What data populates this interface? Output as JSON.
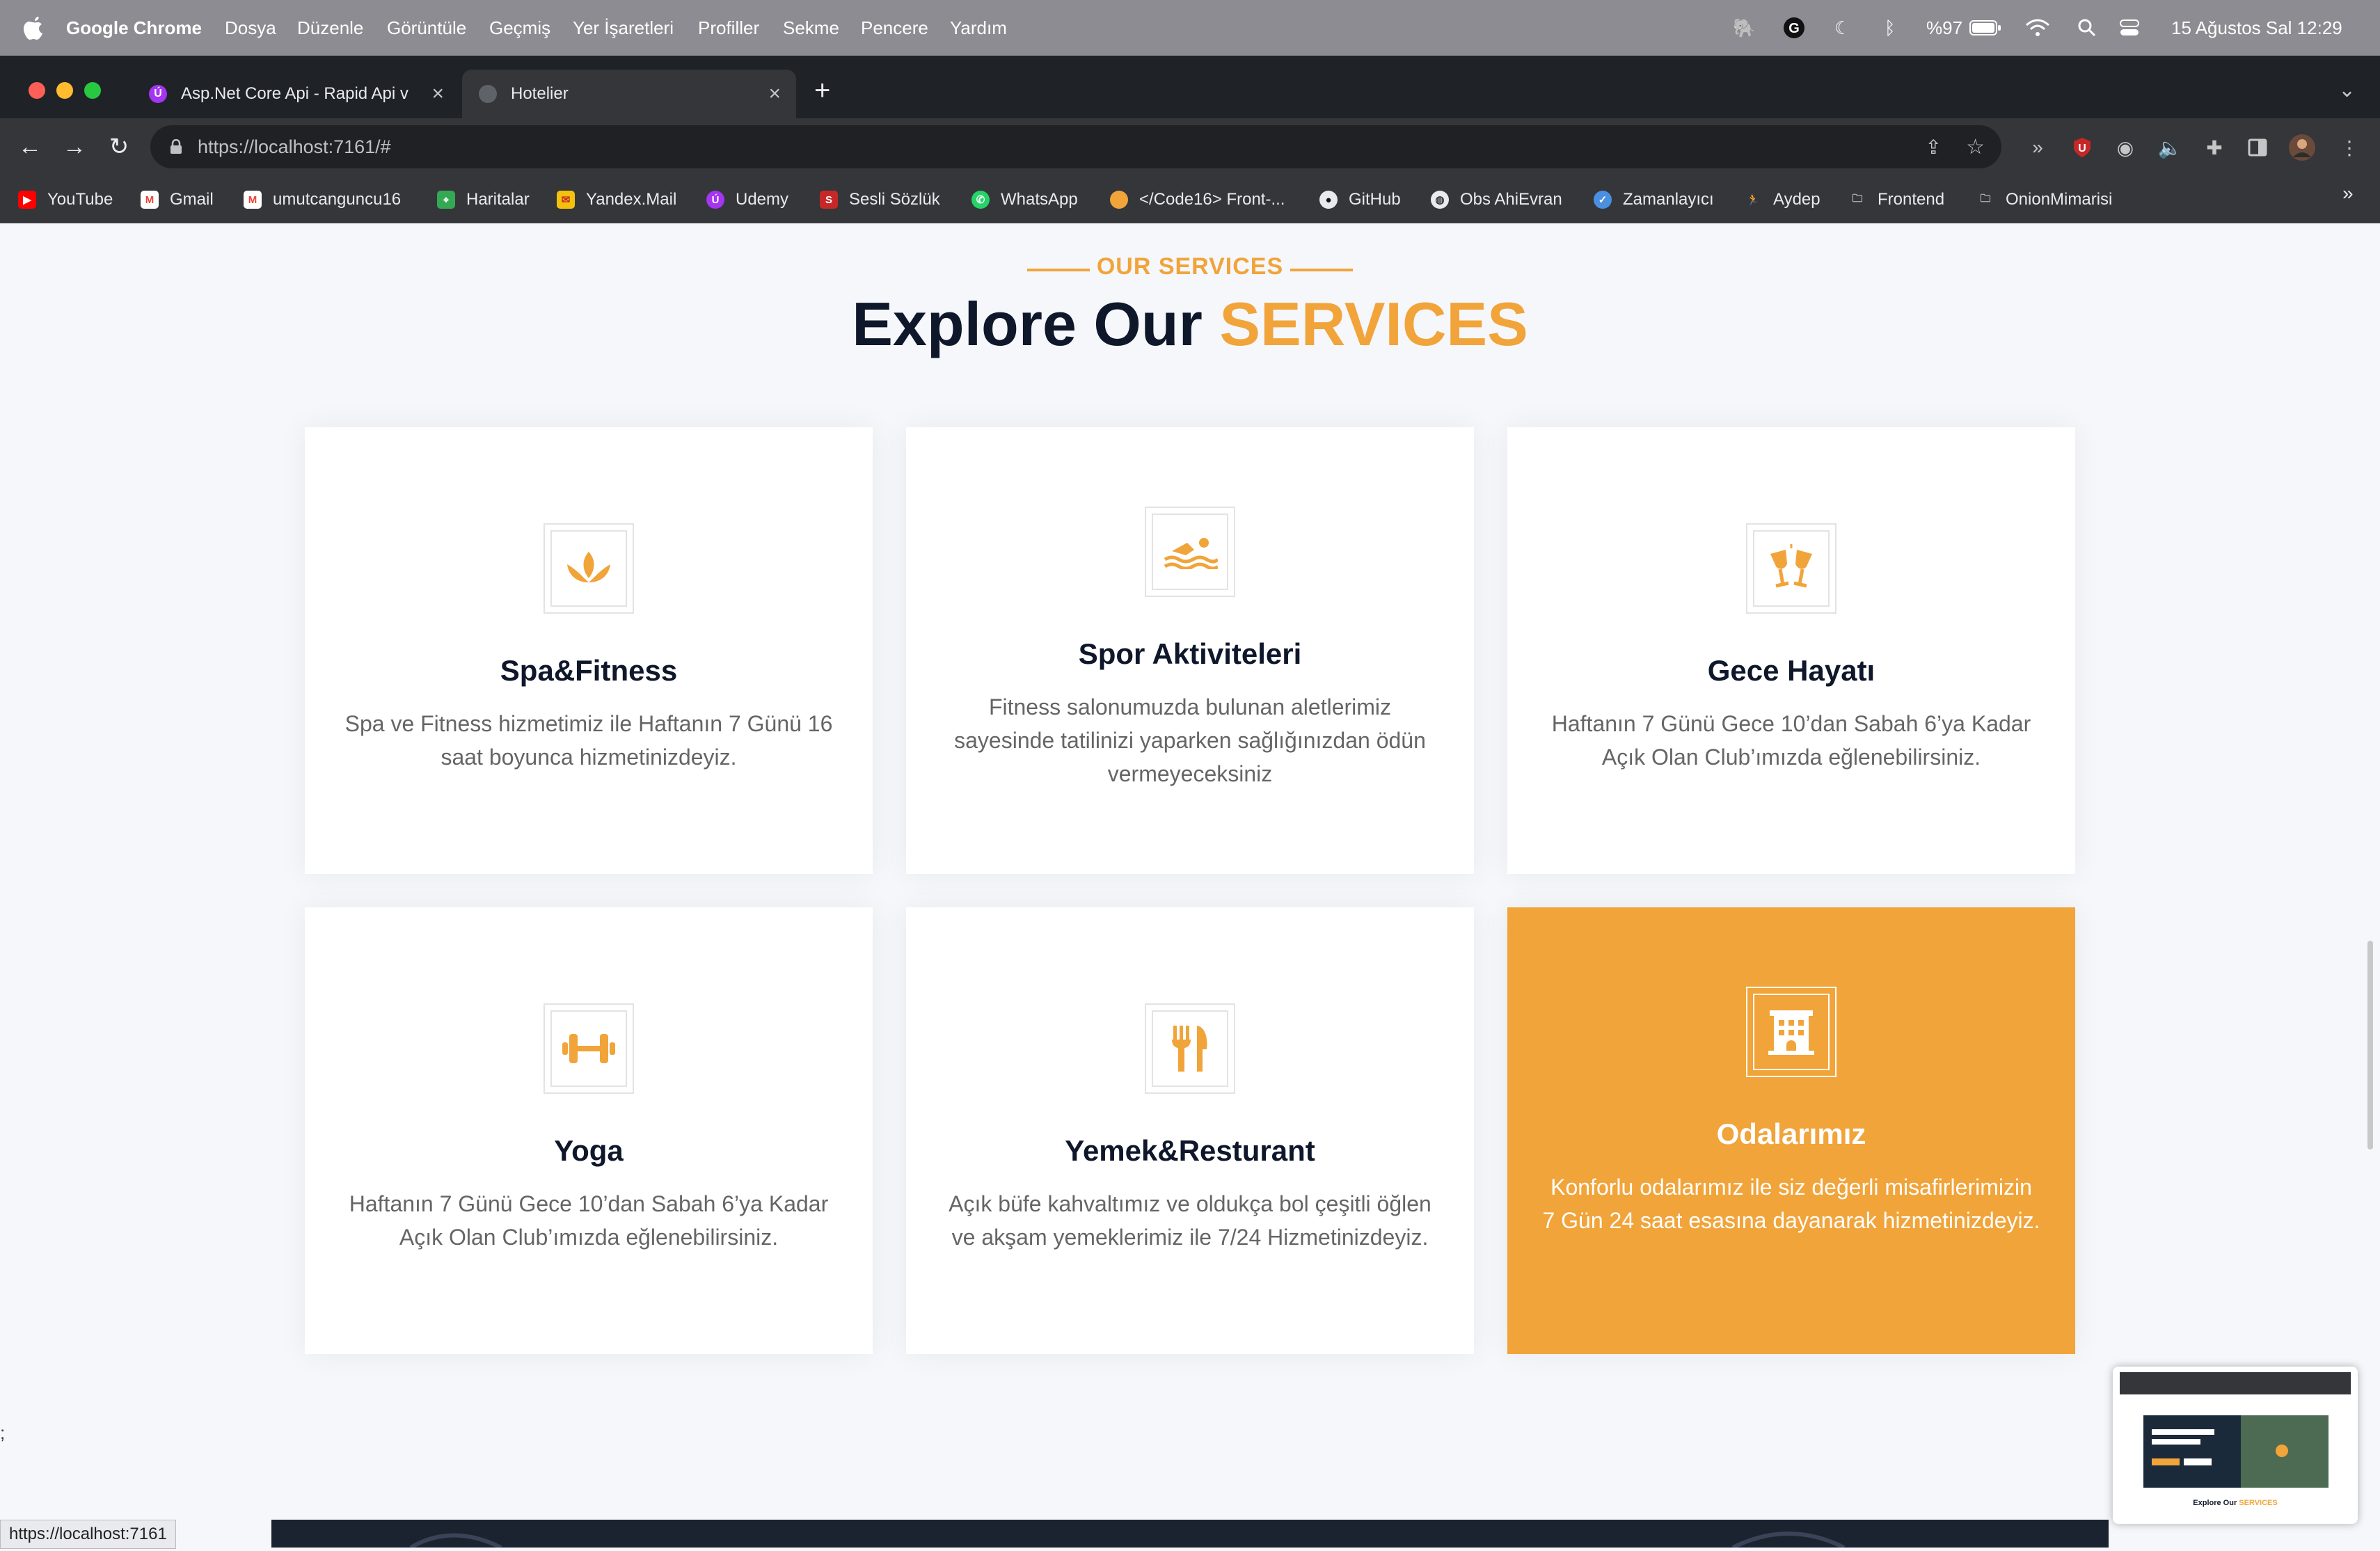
{
  "menubar": {
    "app_name": "Google Chrome",
    "menus": [
      "Dosya",
      "Düzenle",
      "Görüntüle",
      "Geçmiş",
      "Yer İşaretleri",
      "Profiller",
      "Sekme",
      "Pencere",
      "Yardım"
    ],
    "battery": "%97",
    "datetime": "15 Ağustos Sal  12:29"
  },
  "tabs": [
    {
      "title": "Asp.Net Core Api - Rapid Api v",
      "active": false
    },
    {
      "title": "Hotelier",
      "active": true
    }
  ],
  "toolbar": {
    "url": "https://localhost:7161/#"
  },
  "bookmarks": [
    {
      "label": "YouTube",
      "icon": "youtube-icon",
      "color": "#FF0000"
    },
    {
      "label": "Gmail",
      "icon": "gmail-icon",
      "color": "#EA4335"
    },
    {
      "label": "umutcanguncu16",
      "icon": "gmail-icon",
      "color": "#EA4335"
    },
    {
      "label": "Haritalar",
      "icon": "maps-icon",
      "color": "#34A853"
    },
    {
      "label": "Yandex.Mail",
      "icon": "mail-icon",
      "color": "#F4C20D"
    },
    {
      "label": "Udemy",
      "icon": "udemy-icon",
      "color": "#A435F0"
    },
    {
      "label": "Sesli Sözlük",
      "icon": "dictionary-icon",
      "color": "#C62828"
    },
    {
      "label": "WhatsApp",
      "icon": "whatsapp-icon",
      "color": "#25D366"
    },
    {
      "label": "</Code16> Front-...",
      "icon": "code-icon",
      "color": "#F1A43A"
    },
    {
      "label": "GitHub",
      "icon": "github-icon",
      "color": "#333333"
    },
    {
      "label": "Obs AhiEvran",
      "icon": "globe-icon",
      "color": "#E8EAED"
    },
    {
      "label": "Zamanlayıcı",
      "icon": "timer-icon",
      "color": "#4A90E2"
    },
    {
      "label": "Aydep",
      "icon": "runner-icon",
      "color": "#9E9E9E"
    },
    {
      "label": "Frontend",
      "icon": "folder-icon",
      "color": "#C4C7C5"
    },
    {
      "label": "OnionMimarisi",
      "icon": "folder-icon",
      "color": "#C4C7C5"
    }
  ],
  "section": {
    "subtitle": "OUR SERVICES",
    "heading_main": "Explore Our ",
    "heading_accent": "SERVICES",
    "accent_color": "#F1A43A"
  },
  "services": [
    {
      "title": "Spa&Fitness",
      "icon": "lotus-icon",
      "description": "Spa ve Fitness hizmetimiz ile Haftanın 7 Günü 16 saat boyunca hizmetinizdeyiz."
    },
    {
      "title": "Spor Aktiviteleri",
      "icon": "swimmer-icon",
      "description": "Fitness salonumuzda bulunan aletlerimiz sayesinde tatilinizi yaparken sağlığınızdan ödün vermeyeceksiniz"
    },
    {
      "title": "Gece Hayatı",
      "icon": "glasses-cheers-icon",
      "description": "Haftanın 7 Günü Gece 10’dan Sabah 6’ya Kadar Açık Olan Club’ımızda eğlenebilirsiniz."
    },
    {
      "title": "Yoga",
      "icon": "dumbbell-icon",
      "description": "Haftanın 7 Günü Gece 10’dan Sabah 6’ya Kadar Açık Olan Club’ımızda eğlenebilirsiniz."
    },
    {
      "title": "Yemek&Resturant",
      "icon": "utensils-icon",
      "description": "Açık büfe kahvaltımız ve oldukça bol çeşitli öğlen ve akşam yemeklerimiz ile 7/24 Hizmetinizdeyiz."
    },
    {
      "title": "Odalarımız",
      "icon": "hotel-icon",
      "description": "Konforlu odalarımız ile siz değerli misafirlerimizin 7 Gün 24 saat esasına dayanarak hizmetinizdeyiz.",
      "active": true
    }
  ],
  "stray_text": ";",
  "status_url": "https://localhost:7161",
  "pip": {
    "heading_main": "Explore Our ",
    "heading_accent": "SERVICES"
  }
}
